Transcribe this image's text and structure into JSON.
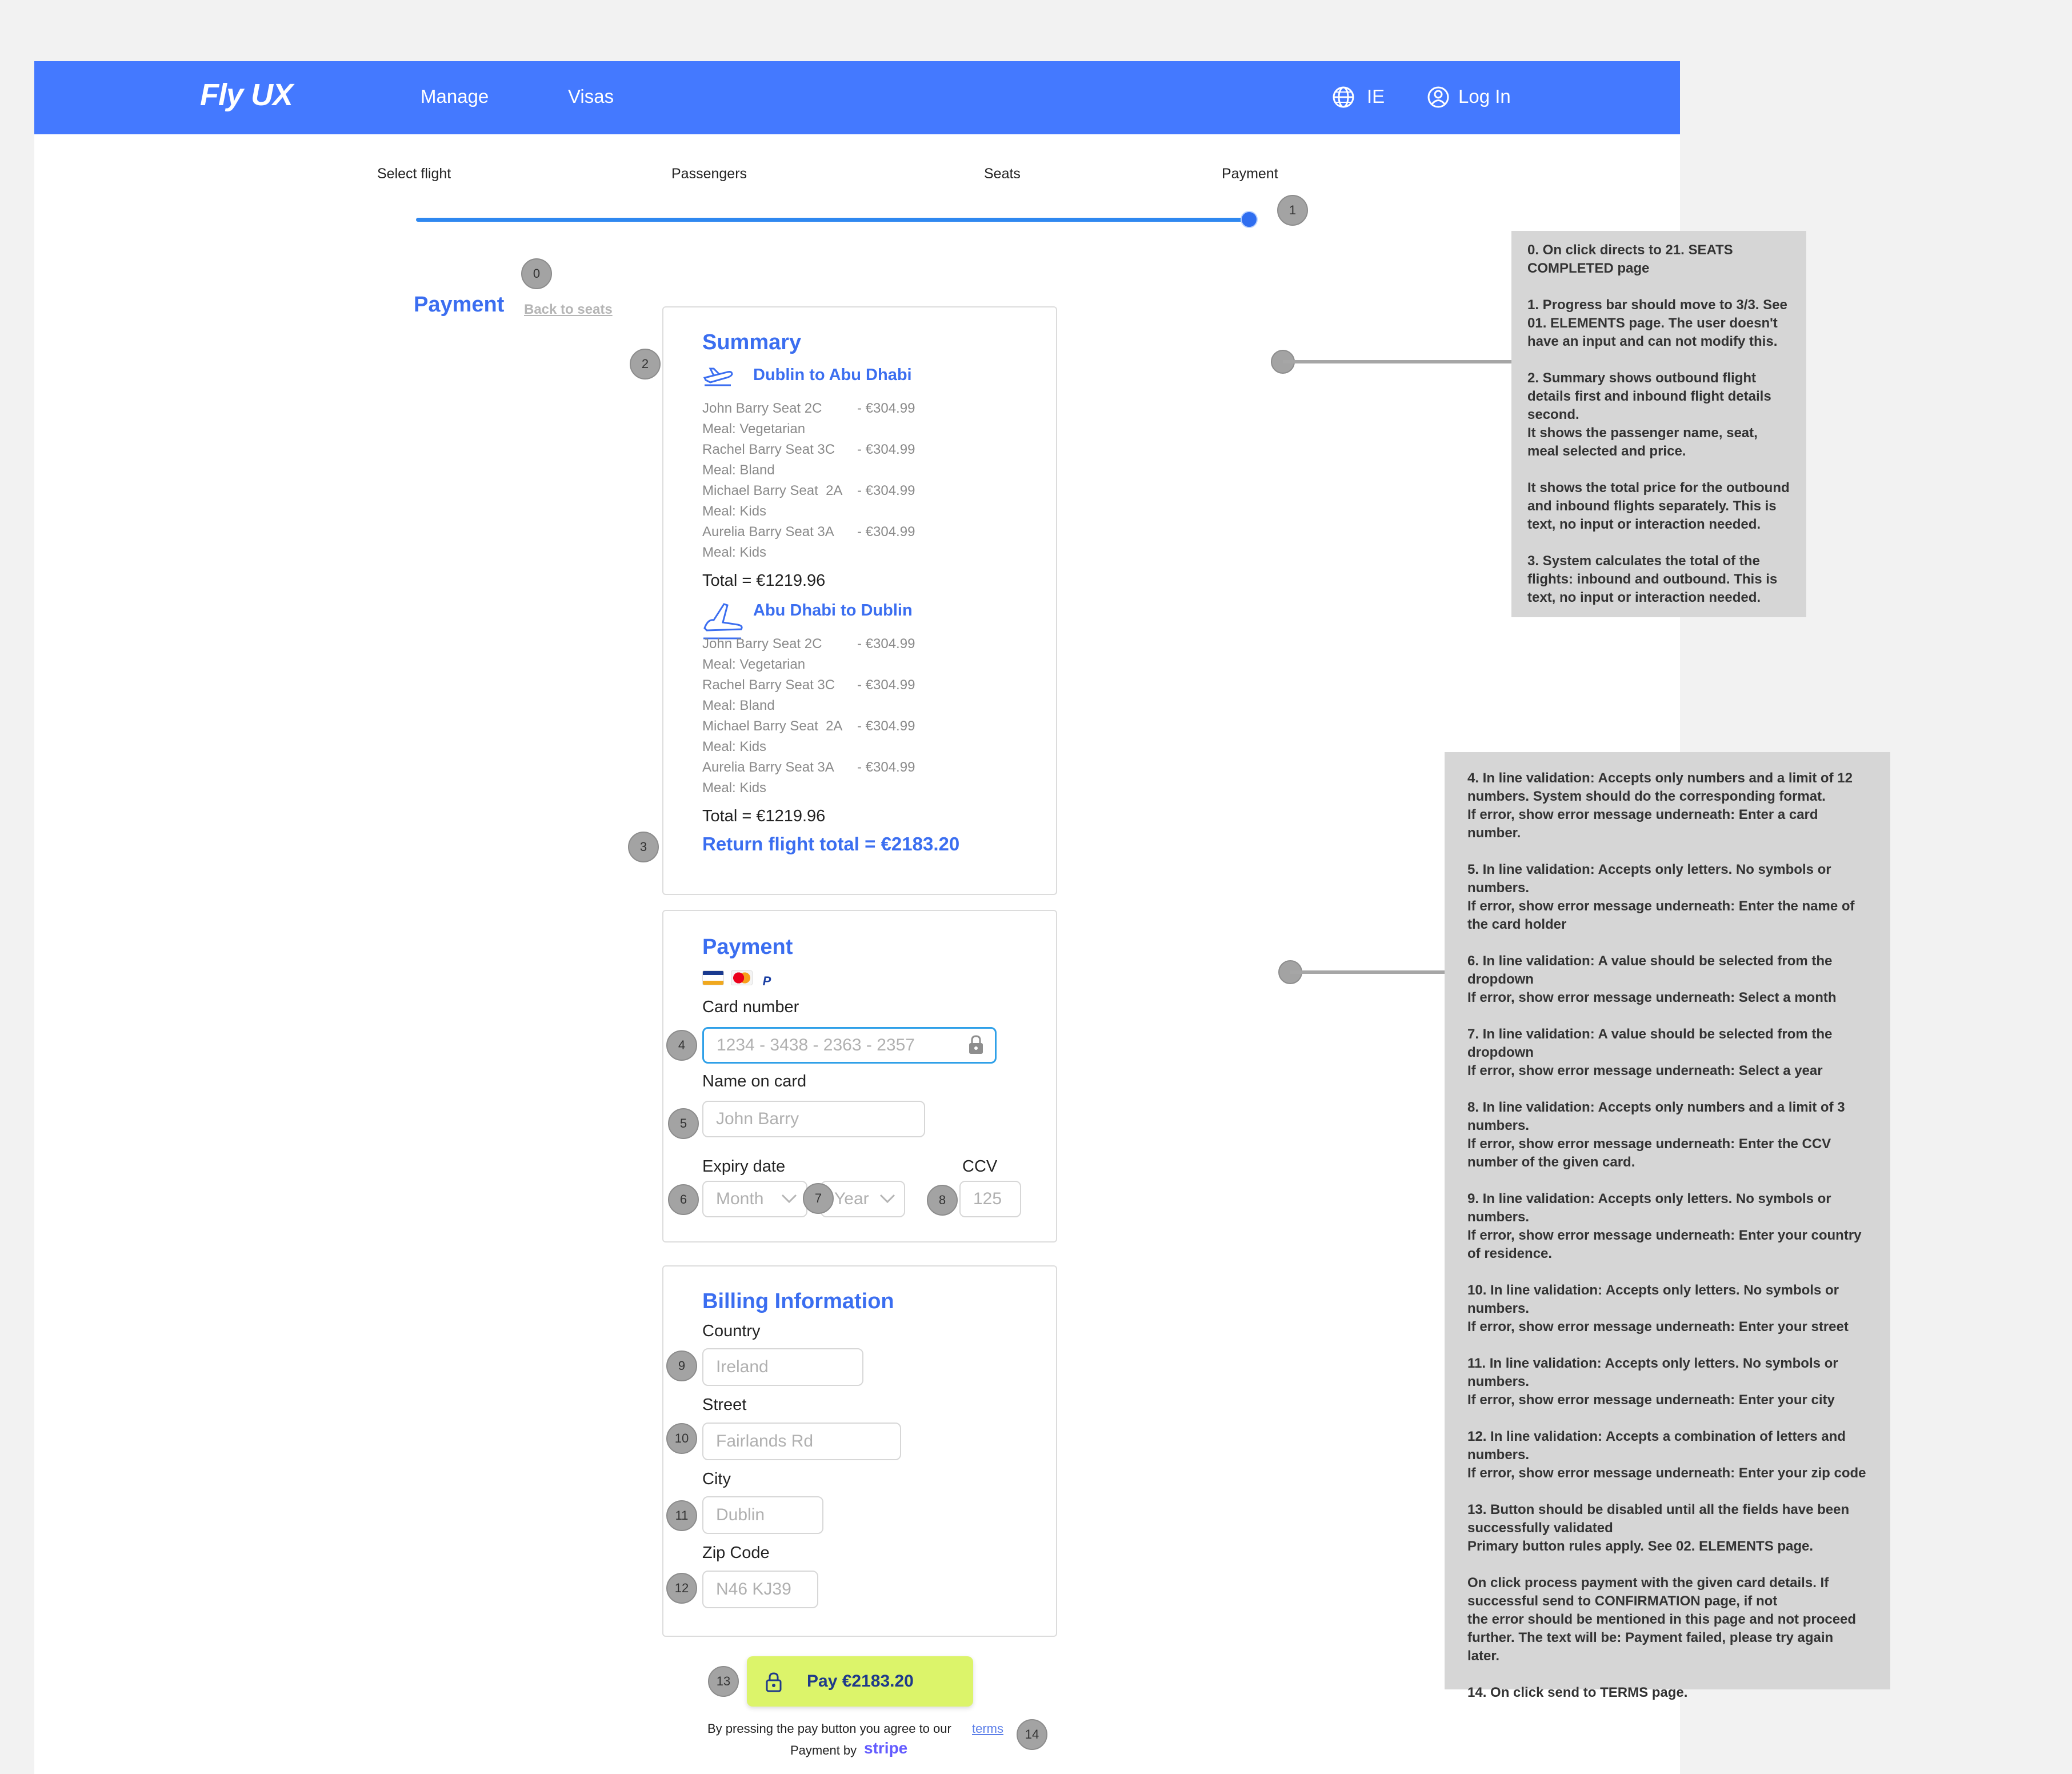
{
  "nav": {
    "logo": "Fly UX",
    "links": [
      "Manage",
      "Visas"
    ],
    "language": "IE",
    "login": "Log In"
  },
  "steps": [
    "Select flight",
    "Passengers",
    "Seats",
    "Payment"
  ],
  "progress": 1.0,
  "markers": [
    "0",
    "1",
    "2",
    "3",
    "4",
    "5",
    "6",
    "7",
    "8",
    "9",
    "10",
    "11",
    "12",
    "13",
    "14"
  ],
  "page": {
    "title": "Payment",
    "back_link": "Back to seats"
  },
  "summary": {
    "title": "Summary",
    "outbound": {
      "route": "Dublin to Abu Dhabi",
      "rows": [
        {
          "name": "John Barry Seat 2C",
          "price": "- €304.99",
          "meal": "Meal: Vegetarian"
        },
        {
          "name": "Rachel Barry Seat 3C",
          "price": "- €304.99",
          "meal": "Meal: Bland"
        },
        {
          "name": "Michael Barry Seat  2A",
          "price": "- €304.99",
          "meal": "Meal: Kids"
        },
        {
          "name": "Aurelia Barry Seat 3A",
          "price": "- €304.99",
          "meal": "Meal: Kids"
        }
      ],
      "total": "Total = €1219.96"
    },
    "inbound": {
      "route": "Abu Dhabi to Dublin",
      "rows": [
        {
          "name": "John Barry Seat 2C",
          "price": "- €304.99",
          "meal": "Meal: Vegetarian"
        },
        {
          "name": "Rachel Barry Seat 3C",
          "price": "- €304.99",
          "meal": "Meal: Bland"
        },
        {
          "name": "Michael Barry Seat  2A",
          "price": "- €304.99",
          "meal": "Meal: Kids"
        },
        {
          "name": "Aurelia Barry Seat 3A",
          "price": "- €304.99",
          "meal": "Meal: Kids"
        }
      ],
      "total": "Total = €1219.96"
    },
    "return_total": "Return flight total = €2183.20"
  },
  "payment": {
    "title": "Payment",
    "card_number_label": "Card number",
    "card_number_placeholder": "1234 - 3438 - 2363 - 2357",
    "name_label": "Name on card",
    "name_placeholder": "John Barry",
    "expiry_label": "Expiry date",
    "month_placeholder": "Month",
    "year_placeholder": "Year",
    "ccv_label": "CCV",
    "ccv_placeholder": "125"
  },
  "billing": {
    "title": "Billing Information",
    "country_label": "Country",
    "country_placeholder": "Ireland",
    "street_label": "Street",
    "street_placeholder": "Fairlands Rd",
    "city_label": "City",
    "city_placeholder": "Dublin",
    "zip_label": "Zip Code",
    "zip_placeholder": "N46 KJ39"
  },
  "pay_button": "Pay €2183.20",
  "terms_text": "By pressing the pay button you agree to our",
  "terms_link": "terms",
  "powered_by": "Payment by",
  "stripe": "stripe",
  "notes_top": [
    "0. On click directs to 21. SEATS COMPLETED page",
    "1. Progress bar should move to 3/3. See 01. ELEMENTS page. The user doesn't have an input and can not modify this.",
    "2. Summary shows outbound flight details first and inbound flight details second.\nIt shows the passenger name, seat, meal selected and price.",
    "It shows the total price for the outbound and inbound flights separately. This is text, no input or interaction needed.",
    "3. System calculates the total of the flights: inbound and outbound. This is text, no input or interaction needed."
  ],
  "notes_bottom": [
    "4. In line validation:  Accepts only numbers and a limit of 12 numbers. System should do the corresponding format.\nIf error, show error message underneath: Enter a card number.",
    "5. In line validation: Accepts only letters. No symbols or numbers.\nIf error, show error message underneath:  Enter the name of the card holder",
    "6. In line validation: A value should be selected from the dropdown\nIf error, show error message underneath: Select a month",
    "7. In line validation: A value should be selected from the dropdown\nIf error, show error message underneath: Select a year",
    "8. In line validation: Accepts only numbers and a limit of 3 numbers.\nIf error, show error message underneath:  Enter the CCV number of the given card.",
    "9. In line validation: Accepts only letters. No symbols or numbers.\nIf error, show error message underneath: Enter your country of residence.",
    "10. In line validation: Accepts only letters. No symbols or numbers.\nIf error, show error message underneath: Enter your street",
    "11. In line validation: Accepts only letters. No symbols or numbers.\nIf error, show error message underneath: Enter your city",
    "12. In line validation: Accepts a combination of letters and numbers.\nIf error, show error message underneath: Enter your zip code",
    "13. Button should be disabled until all the fields have been successfully validated\nPrimary button rules apply. See 02. ELEMENTS page.",
    "On click process payment with the given card details. If successful send to CONFIRMATION page, if not\nthe error should be mentioned in this page and not proceed further. The text will be: Payment failed, please try again later.",
    "14. On click send to TERMS page."
  ],
  "colors": {
    "brand": "#4479ff",
    "accent_text": "#3b6ef0",
    "pay_button": "#dcf46a",
    "note_bg": "#d6d6d6"
  }
}
